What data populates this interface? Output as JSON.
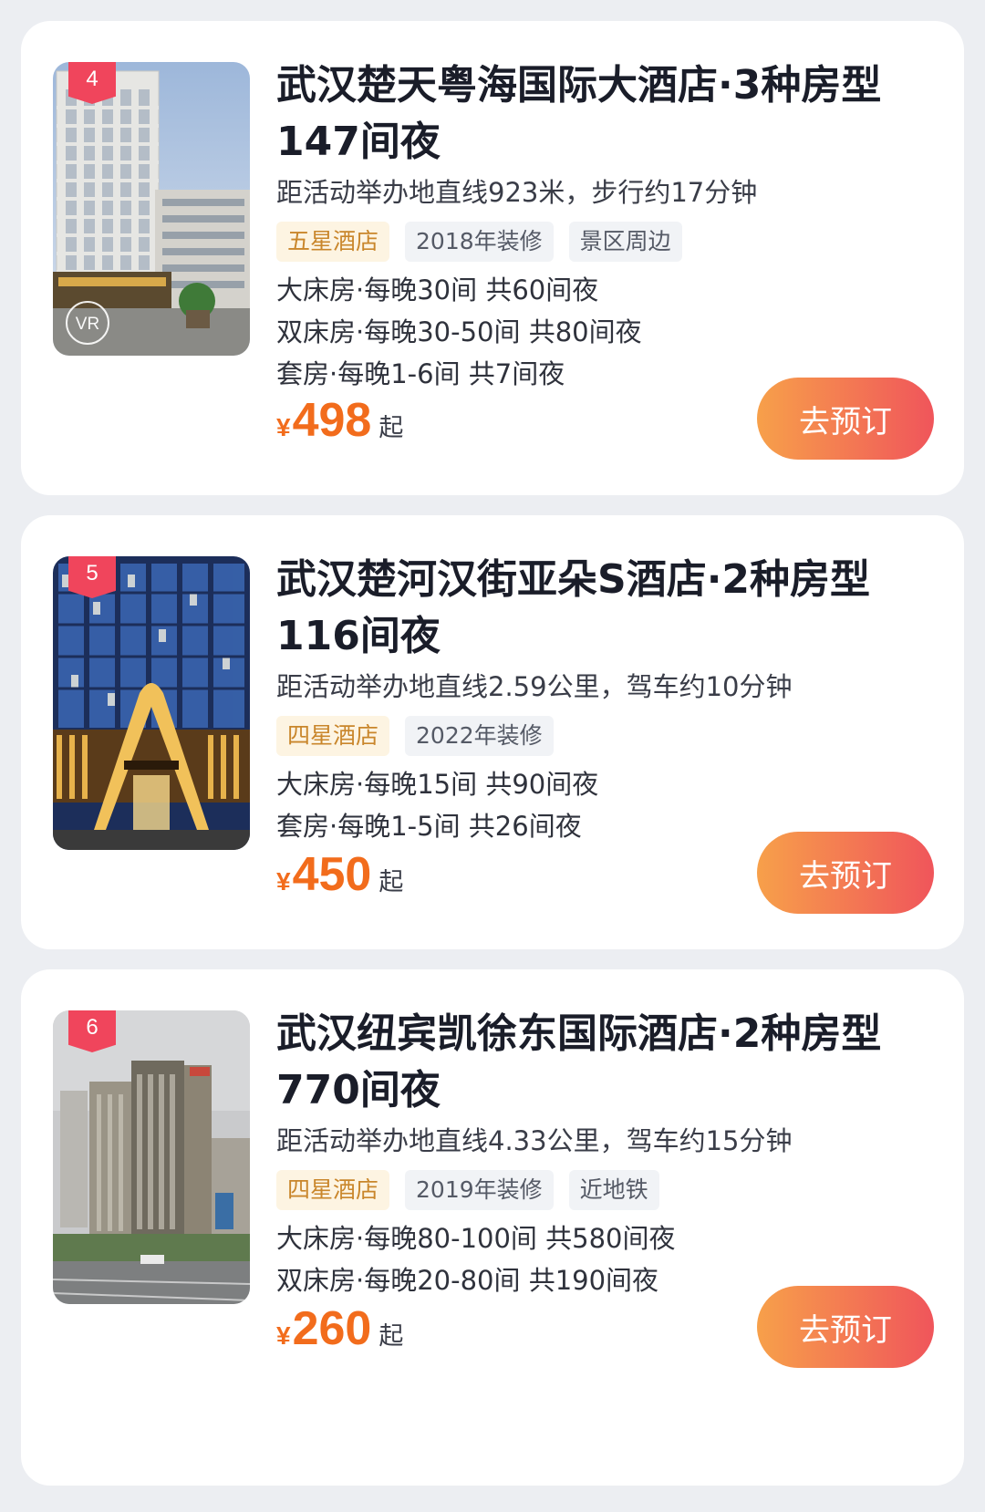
{
  "hotels": [
    {
      "rank": "4",
      "vr": "VR",
      "title": "武汉楚天粤海国际大酒店·3种房型147间夜",
      "distance": "距活动举办地直线923米，步行约17分钟",
      "tags": [
        "五星酒店",
        "2018年装修",
        "景区周边"
      ],
      "rooms": [
        "大床房·每晚30间 共60间夜",
        "双床房·每晚30-50间 共80间夜",
        "套房·每晚1-6间 共7间夜"
      ],
      "currency": "¥",
      "price": "498",
      "price_suffix": "起",
      "button_label": "去预订"
    },
    {
      "rank": "5",
      "title": "武汉楚河汉街亚朵S酒店·2种房型116间夜",
      "distance": "距活动举办地直线2.59公里，驾车约10分钟",
      "tags": [
        "四星酒店",
        "2022年装修"
      ],
      "rooms": [
        "大床房·每晚15间 共90间夜",
        "套房·每晚1-5间 共26间夜"
      ],
      "currency": "¥",
      "price": "450",
      "price_suffix": "起",
      "button_label": "去预订"
    },
    {
      "rank": "6",
      "title": "武汉纽宾凯徐东国际酒店·2种房型770间夜",
      "distance": "距活动举办地直线4.33公里，驾车约15分钟",
      "tags": [
        "四星酒店",
        "2019年装修",
        "近地铁"
      ],
      "rooms": [
        "大床房·每晚80-100间 共580间夜",
        "双床房·每晚20-80间 共190间夜"
      ],
      "currency": "¥",
      "price": "260",
      "price_suffix": "起",
      "button_label": "去预订"
    }
  ],
  "colors": {
    "page_bg": "#eceef2",
    "price": "#f26c1c",
    "rank_badge": "#f0455c",
    "button_gradient_start": "#f7a04a",
    "button_gradient_end": "#f0555b",
    "star_tag_bg": "#fdf4e2",
    "star_tag_text": "#c9862b"
  },
  "icons": {
    "vr": "vr-circle-icon",
    "rank": "rank-ribbon-icon"
  }
}
